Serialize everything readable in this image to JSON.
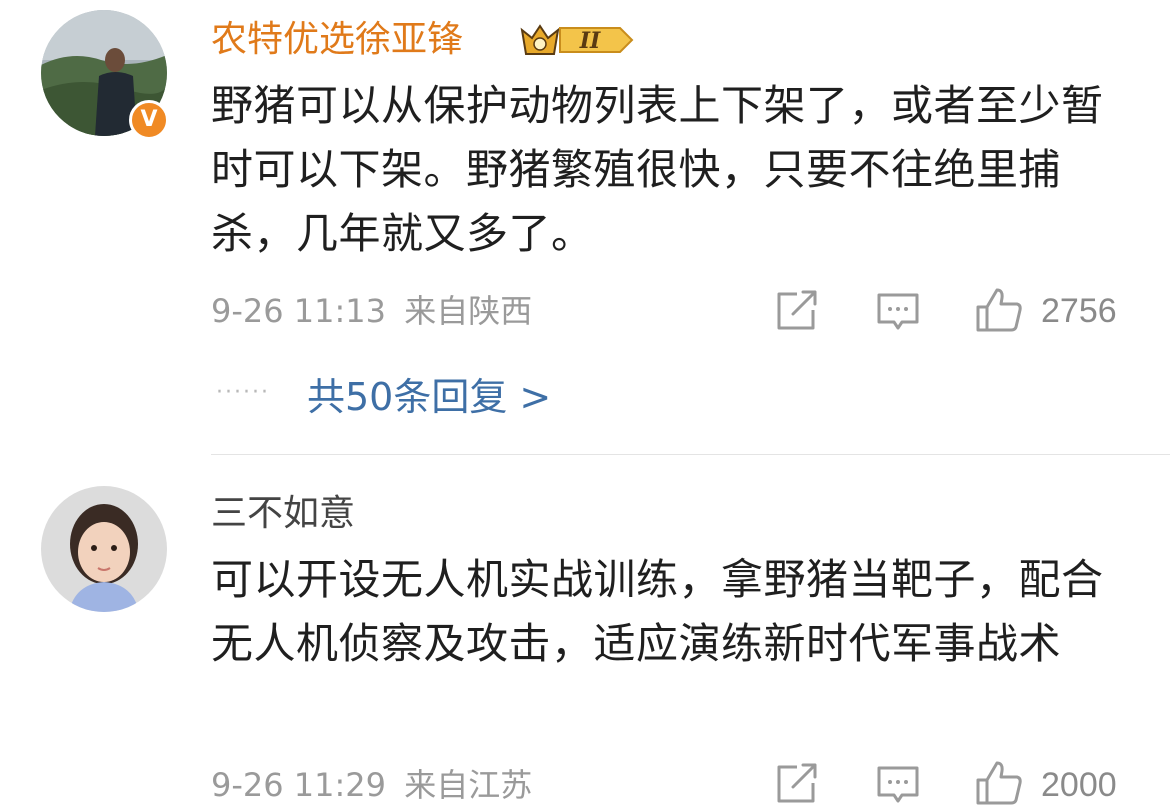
{
  "comments": [
    {
      "username": "农特优选徐亚锋",
      "verified_badge": "V",
      "rank_badge": "II",
      "text": "野猪可以从保护动物列表上下架了，或者至少暂时可以下架。野猪繁殖很快，只要不往绝里捕杀，几年就又多了。",
      "date": "9-26 11:13",
      "location": "来自陕西",
      "likes": "2756",
      "replies_label": "共50条回复 >"
    },
    {
      "username": "三不如意",
      "text": "可以开设无人机实战训练，拿野猪当靶子，配合无人机侦察及攻击，适应演练新时代军事战术",
      "date": "9-26 11:29",
      "location": "来自江苏",
      "likes": "2000"
    }
  ],
  "icons": [
    "share-icon",
    "comment-icon",
    "like-icon"
  ],
  "colors": {
    "username_orange": "#e07a1a",
    "link_blue": "#3e6fa6",
    "meta_gray": "#9a9a9a",
    "badge_orange": "#f08a24"
  }
}
